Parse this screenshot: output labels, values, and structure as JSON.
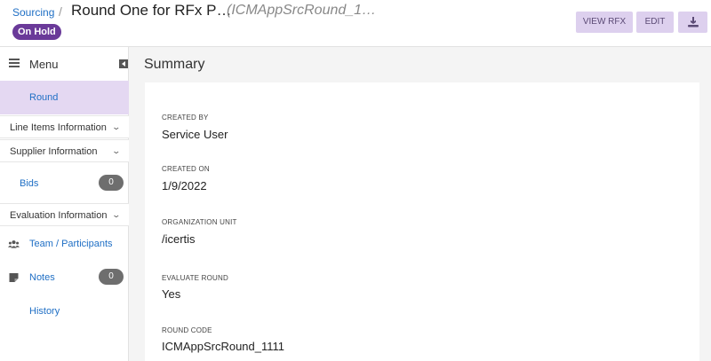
{
  "header": {
    "breadcrumb": "Sourcing",
    "separator": "/",
    "title": "Round One for RFx P…",
    "subtitle": "(ICMAppSrcRound_1…",
    "status": "On Hold",
    "buttons": {
      "view": "VIEW RFX",
      "edit": "EDIT",
      "more_icon": "hand-share-icon"
    }
  },
  "sidebar": {
    "menu_label": "Menu",
    "active_item": "Round",
    "sections": {
      "line_items": "Line Items Information",
      "supplier": "Supplier Information",
      "evaluation": "Evaluation Information"
    },
    "items": {
      "bids": {
        "label": "Bids",
        "count": "0"
      },
      "team": {
        "label": "Team / Participants",
        "icon": "people-icon"
      },
      "notes": {
        "label": "Notes",
        "count": "0",
        "icon": "note-icon"
      },
      "history": {
        "label": "History"
      }
    }
  },
  "main": {
    "title": "Summary",
    "fields": [
      {
        "label": "CREATED BY",
        "value": "Service User"
      },
      {
        "label": "CREATED ON",
        "value": "1/9/2022"
      },
      {
        "label": "ORGANIZATION UNIT",
        "value": "/icertis"
      },
      {
        "label": "EVALUATE ROUND",
        "value": "Yes"
      },
      {
        "label": "ROUND CODE",
        "value": "ICMAppSrcRound_1111"
      }
    ]
  },
  "colors": {
    "accent": "#6a3a99",
    "link": "#1f6fc5",
    "active_bg": "#e4d8f2",
    "button_bg": "#ddd0ee"
  }
}
